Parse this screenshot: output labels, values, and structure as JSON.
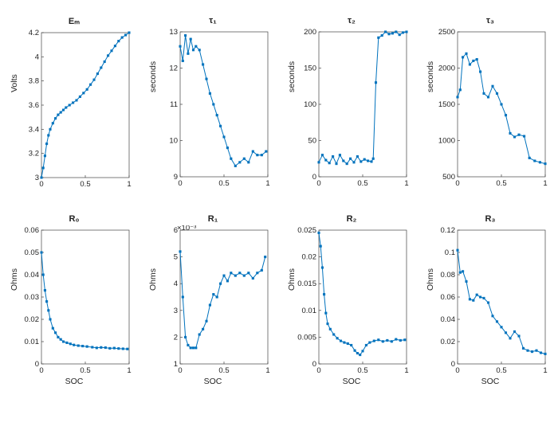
{
  "charts": [
    {
      "id": "Em",
      "title": "Eₘ",
      "ylabel": "Volts",
      "xlabel": "",
      "ylim": [
        3,
        4.2
      ],
      "yticks": [
        3,
        3.2,
        3.4,
        3.6,
        3.8,
        4,
        4.2
      ],
      "ytickfmt": "g",
      "xlim": [
        0,
        1
      ],
      "xticks": [
        0,
        0.5,
        1
      ],
      "data": [
        [
          0,
          3.0
        ],
        [
          0.02,
          3.08
        ],
        [
          0.04,
          3.18
        ],
        [
          0.06,
          3.28
        ],
        [
          0.08,
          3.35
        ],
        [
          0.1,
          3.4
        ],
        [
          0.13,
          3.45
        ],
        [
          0.16,
          3.49
        ],
        [
          0.19,
          3.52
        ],
        [
          0.22,
          3.54
        ],
        [
          0.25,
          3.56
        ],
        [
          0.28,
          3.58
        ],
        [
          0.32,
          3.6
        ],
        [
          0.36,
          3.62
        ],
        [
          0.4,
          3.64
        ],
        [
          0.44,
          3.67
        ],
        [
          0.48,
          3.7
        ],
        [
          0.52,
          3.73
        ],
        [
          0.56,
          3.77
        ],
        [
          0.6,
          3.81
        ],
        [
          0.64,
          3.86
        ],
        [
          0.68,
          3.91
        ],
        [
          0.72,
          3.96
        ],
        [
          0.76,
          4.01
        ],
        [
          0.8,
          4.05
        ],
        [
          0.84,
          4.09
        ],
        [
          0.88,
          4.13
        ],
        [
          0.92,
          4.16
        ],
        [
          0.96,
          4.18
        ],
        [
          1.0,
          4.2
        ]
      ]
    },
    {
      "id": "tau1",
      "title": "τ₁",
      "ylabel": "seconds",
      "xlabel": "",
      "ylim": [
        9,
        13
      ],
      "yticks": [
        9,
        10,
        11,
        12,
        13
      ],
      "ytickfmt": "d",
      "xlim": [
        0,
        1
      ],
      "xticks": [
        0,
        0.5,
        1
      ],
      "data": [
        [
          0,
          12.6
        ],
        [
          0.03,
          12.2
        ],
        [
          0.06,
          12.9
        ],
        [
          0.09,
          12.4
        ],
        [
          0.12,
          12.8
        ],
        [
          0.15,
          12.5
        ],
        [
          0.18,
          12.6
        ],
        [
          0.22,
          12.5
        ],
        [
          0.26,
          12.1
        ],
        [
          0.3,
          11.7
        ],
        [
          0.34,
          11.3
        ],
        [
          0.38,
          11.0
        ],
        [
          0.42,
          10.7
        ],
        [
          0.46,
          10.4
        ],
        [
          0.5,
          10.1
        ],
        [
          0.54,
          9.8
        ],
        [
          0.58,
          9.5
        ],
        [
          0.63,
          9.3
        ],
        [
          0.68,
          9.4
        ],
        [
          0.73,
          9.5
        ],
        [
          0.78,
          9.4
        ],
        [
          0.83,
          9.7
        ],
        [
          0.88,
          9.6
        ],
        [
          0.93,
          9.6
        ],
        [
          0.98,
          9.7
        ]
      ]
    },
    {
      "id": "tau2",
      "title": "τ₂",
      "ylabel": "seconds",
      "xlabel": "",
      "ylim": [
        0,
        200
      ],
      "yticks": [
        0,
        50,
        100,
        150,
        200
      ],
      "ytickfmt": "d",
      "xlim": [
        0,
        1
      ],
      "xticks": [
        0,
        0.5,
        1
      ],
      "data": [
        [
          0,
          20
        ],
        [
          0.04,
          30
        ],
        [
          0.08,
          23
        ],
        [
          0.12,
          19
        ],
        [
          0.16,
          28
        ],
        [
          0.2,
          18
        ],
        [
          0.24,
          30
        ],
        [
          0.28,
          22
        ],
        [
          0.32,
          18
        ],
        [
          0.36,
          25
        ],
        [
          0.4,
          20
        ],
        [
          0.44,
          28
        ],
        [
          0.48,
          21
        ],
        [
          0.52,
          24
        ],
        [
          0.56,
          22
        ],
        [
          0.6,
          21
        ],
        [
          0.62,
          25
        ],
        [
          0.65,
          130
        ],
        [
          0.68,
          192
        ],
        [
          0.72,
          195
        ],
        [
          0.76,
          200
        ],
        [
          0.8,
          197
        ],
        [
          0.84,
          198
        ],
        [
          0.88,
          200
        ],
        [
          0.92,
          196
        ],
        [
          0.96,
          199
        ],
        [
          1.0,
          200
        ]
      ]
    },
    {
      "id": "tau3",
      "title": "τ₃",
      "ylabel": "seconds",
      "xlabel": "",
      "ylim": [
        500,
        2500
      ],
      "yticks": [
        500,
        1000,
        1500,
        2000,
        2500
      ],
      "ytickfmt": "d",
      "xlim": [
        0,
        1
      ],
      "xticks": [
        0,
        0.5,
        1
      ],
      "data": [
        [
          0,
          1600
        ],
        [
          0.03,
          1700
        ],
        [
          0.06,
          2150
        ],
        [
          0.1,
          2200
        ],
        [
          0.14,
          2050
        ],
        [
          0.18,
          2100
        ],
        [
          0.22,
          2120
        ],
        [
          0.26,
          1950
        ],
        [
          0.3,
          1650
        ],
        [
          0.35,
          1600
        ],
        [
          0.4,
          1750
        ],
        [
          0.45,
          1650
        ],
        [
          0.5,
          1500
        ],
        [
          0.55,
          1350
        ],
        [
          0.6,
          1100
        ],
        [
          0.65,
          1050
        ],
        [
          0.7,
          1080
        ],
        [
          0.76,
          1060
        ],
        [
          0.82,
          760
        ],
        [
          0.88,
          720
        ],
        [
          0.94,
          700
        ],
        [
          1.0,
          680
        ]
      ]
    },
    {
      "id": "R0",
      "title": "R₀",
      "ylabel": "Ohms",
      "xlabel": "SOC",
      "ylim": [
        0,
        0.06
      ],
      "yticks": [
        0,
        0.01,
        0.02,
        0.03,
        0.04,
        0.05,
        0.06
      ],
      "ytickfmt": "2",
      "xlim": [
        0,
        1
      ],
      "xticks": [
        0,
        0.5,
        1
      ],
      "data": [
        [
          0,
          0.05
        ],
        [
          0.02,
          0.04
        ],
        [
          0.04,
          0.033
        ],
        [
          0.06,
          0.028
        ],
        [
          0.08,
          0.024
        ],
        [
          0.1,
          0.02
        ],
        [
          0.13,
          0.016
        ],
        [
          0.16,
          0.014
        ],
        [
          0.19,
          0.012
        ],
        [
          0.22,
          0.011
        ],
        [
          0.25,
          0.01
        ],
        [
          0.29,
          0.0095
        ],
        [
          0.33,
          0.009
        ],
        [
          0.37,
          0.0085
        ],
        [
          0.42,
          0.0082
        ],
        [
          0.47,
          0.008
        ],
        [
          0.52,
          0.0078
        ],
        [
          0.58,
          0.0075
        ],
        [
          0.63,
          0.0072
        ],
        [
          0.68,
          0.0074
        ],
        [
          0.73,
          0.0073
        ],
        [
          0.78,
          0.007
        ],
        [
          0.83,
          0.0071
        ],
        [
          0.88,
          0.0069
        ],
        [
          0.93,
          0.0068
        ],
        [
          0.98,
          0.0067
        ]
      ]
    },
    {
      "id": "R1",
      "title": "R₁",
      "ylabel": "Ohms",
      "xlabel": "SOC",
      "exp": "×10⁻³",
      "ylim": [
        1,
        6
      ],
      "yticks": [
        1,
        2,
        3,
        4,
        5,
        6
      ],
      "ytickfmt": "d",
      "scale": 0.001,
      "xlim": [
        0,
        1
      ],
      "xticks": [
        0,
        0.5,
        1
      ],
      "data": [
        [
          0,
          5.2
        ],
        [
          0.03,
          3.5
        ],
        [
          0.06,
          2.0
        ],
        [
          0.09,
          1.7
        ],
        [
          0.12,
          1.6
        ],
        [
          0.15,
          1.6
        ],
        [
          0.18,
          1.6
        ],
        [
          0.22,
          2.1
        ],
        [
          0.26,
          2.3
        ],
        [
          0.3,
          2.6
        ],
        [
          0.34,
          3.2
        ],
        [
          0.38,
          3.6
        ],
        [
          0.42,
          3.5
        ],
        [
          0.46,
          4.0
        ],
        [
          0.5,
          4.3
        ],
        [
          0.54,
          4.1
        ],
        [
          0.58,
          4.4
        ],
        [
          0.63,
          4.3
        ],
        [
          0.68,
          4.4
        ],
        [
          0.73,
          4.3
        ],
        [
          0.78,
          4.4
        ],
        [
          0.83,
          4.2
        ],
        [
          0.88,
          4.4
        ],
        [
          0.93,
          4.5
        ],
        [
          0.97,
          5.0
        ]
      ]
    },
    {
      "id": "R2",
      "title": "R₂",
      "ylabel": "Ohms",
      "xlabel": "SOC",
      "ylim": [
        0,
        0.025
      ],
      "yticks": [
        0,
        0.005,
        0.01,
        0.015,
        0.02,
        0.025
      ],
      "ytickfmt": "3",
      "xlim": [
        0,
        1
      ],
      "xticks": [
        0,
        0.5,
        1
      ],
      "data": [
        [
          0,
          0.0245
        ],
        [
          0.02,
          0.022
        ],
        [
          0.04,
          0.018
        ],
        [
          0.06,
          0.013
        ],
        [
          0.08,
          0.0095
        ],
        [
          0.1,
          0.0075
        ],
        [
          0.13,
          0.0065
        ],
        [
          0.17,
          0.0055
        ],
        [
          0.21,
          0.0048
        ],
        [
          0.25,
          0.0043
        ],
        [
          0.29,
          0.004
        ],
        [
          0.33,
          0.0038
        ],
        [
          0.37,
          0.0035
        ],
        [
          0.41,
          0.0025
        ],
        [
          0.44,
          0.002
        ],
        [
          0.47,
          0.0017
        ],
        [
          0.5,
          0.0024
        ],
        [
          0.54,
          0.0035
        ],
        [
          0.58,
          0.004
        ],
        [
          0.63,
          0.0043
        ],
        [
          0.68,
          0.0045
        ],
        [
          0.73,
          0.0042
        ],
        [
          0.78,
          0.0044
        ],
        [
          0.83,
          0.0042
        ],
        [
          0.88,
          0.0046
        ],
        [
          0.93,
          0.0044
        ],
        [
          0.98,
          0.0045
        ]
      ]
    },
    {
      "id": "R3",
      "title": "R₃",
      "ylabel": "Ohms",
      "xlabel": "SOC",
      "ylim": [
        0,
        0.12
      ],
      "yticks": [
        0,
        0.02,
        0.04,
        0.06,
        0.08,
        0.1,
        0.12
      ],
      "ytickfmt": "2",
      "xlim": [
        0,
        1
      ],
      "xticks": [
        0,
        0.5,
        1
      ],
      "data": [
        [
          0,
          0.102
        ],
        [
          0.03,
          0.082
        ],
        [
          0.06,
          0.083
        ],
        [
          0.1,
          0.074
        ],
        [
          0.14,
          0.058
        ],
        [
          0.18,
          0.057
        ],
        [
          0.22,
          0.062
        ],
        [
          0.26,
          0.06
        ],
        [
          0.3,
          0.059
        ],
        [
          0.35,
          0.055
        ],
        [
          0.4,
          0.043
        ],
        [
          0.45,
          0.038
        ],
        [
          0.5,
          0.033
        ],
        [
          0.55,
          0.028
        ],
        [
          0.6,
          0.023
        ],
        [
          0.65,
          0.029
        ],
        [
          0.7,
          0.025
        ],
        [
          0.75,
          0.014
        ],
        [
          0.8,
          0.012
        ],
        [
          0.85,
          0.011
        ],
        [
          0.9,
          0.012
        ],
        [
          0.95,
          0.01
        ],
        [
          1.0,
          0.009
        ]
      ]
    }
  ],
  "chart_data": "see charts[] above — each entry's data is [SOC, value] pairs"
}
